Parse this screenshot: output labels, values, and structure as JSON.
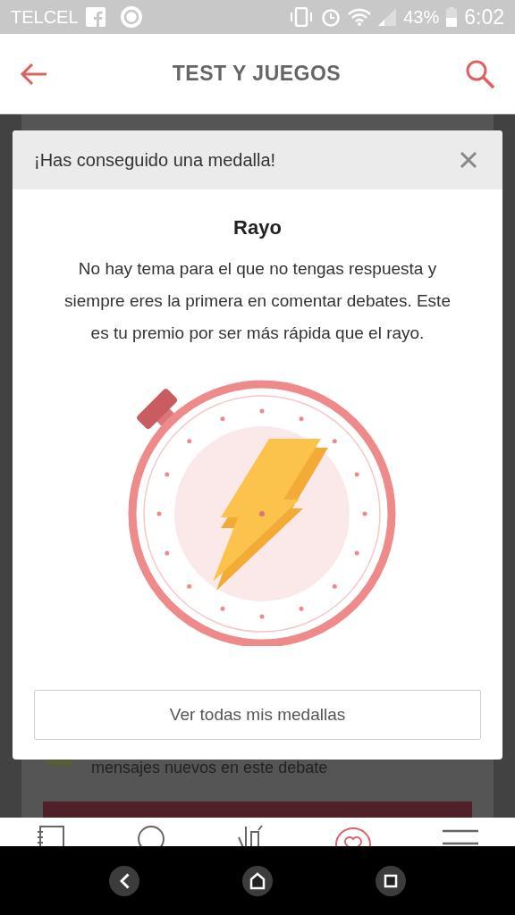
{
  "status_bar": {
    "carrier": "TELCEL",
    "battery": "43%",
    "time": "6:02"
  },
  "header": {
    "title": "TEST Y JUEGOS"
  },
  "page_behind": {
    "notice": "mensajes nuevos en este debate"
  },
  "modal": {
    "title": "¡Has conseguido una medalla!",
    "medal_name": "Rayo",
    "description": "No hay tema para el que no tengas respuesta y siempre eres la primera en comentar debates. Este es tu premio por ser más rápida que el rayo.",
    "button": "Ver todas mis medallas"
  }
}
